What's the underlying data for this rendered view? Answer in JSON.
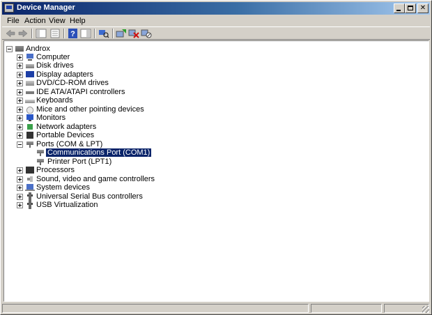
{
  "window": {
    "title": "Device Manager"
  },
  "menu": {
    "items": [
      "File",
      "Action",
      "View",
      "Help"
    ]
  },
  "toolbar": {
    "buttons": [
      "back-icon",
      "forward-icon",
      "show-hide-tree-icon",
      "properties-icon",
      "help-icon",
      "action-pane-icon",
      "scan-hardware-icon",
      "update-driver-icon",
      "uninstall-icon",
      "disable-icon"
    ]
  },
  "tree": {
    "root": "Androx",
    "categories": [
      {
        "label": "Computer",
        "icon": "computer-icon"
      },
      {
        "label": "Disk drives",
        "icon": "disk-drive-icon"
      },
      {
        "label": "Display adapters",
        "icon": "display-adapter-icon"
      },
      {
        "label": "DVD/CD-ROM drives",
        "icon": "dvd-drive-icon"
      },
      {
        "label": "IDE ATA/ATAPI controllers",
        "icon": "ide-controller-icon"
      },
      {
        "label": "Keyboards",
        "icon": "keyboard-icon"
      },
      {
        "label": "Mice and other pointing devices",
        "icon": "mouse-icon"
      },
      {
        "label": "Monitors",
        "icon": "monitor-icon"
      },
      {
        "label": "Network adapters",
        "icon": "network-adapter-icon"
      },
      {
        "label": "Portable Devices",
        "icon": "portable-device-icon"
      },
      {
        "label": "Ports (COM & LPT)",
        "icon": "port-icon",
        "expanded": true,
        "children": [
          {
            "label": "Communications Port (COM1)",
            "icon": "port-icon",
            "selected": true
          },
          {
            "label": "Printer Port (LPT1)",
            "icon": "port-icon"
          }
        ]
      },
      {
        "label": "Processors",
        "icon": "processor-icon"
      },
      {
        "label": "Sound, video and game controllers",
        "icon": "sound-icon"
      },
      {
        "label": "System devices",
        "icon": "system-device-icon"
      },
      {
        "label": "Universal Serial Bus controllers",
        "icon": "usb-icon"
      },
      {
        "label": "USB Virtualization",
        "icon": "usb-icon"
      }
    ]
  },
  "colors": {
    "selection": "#0a246a",
    "titlebar": "#0a246a",
    "chrome": "#d4d0c8"
  }
}
